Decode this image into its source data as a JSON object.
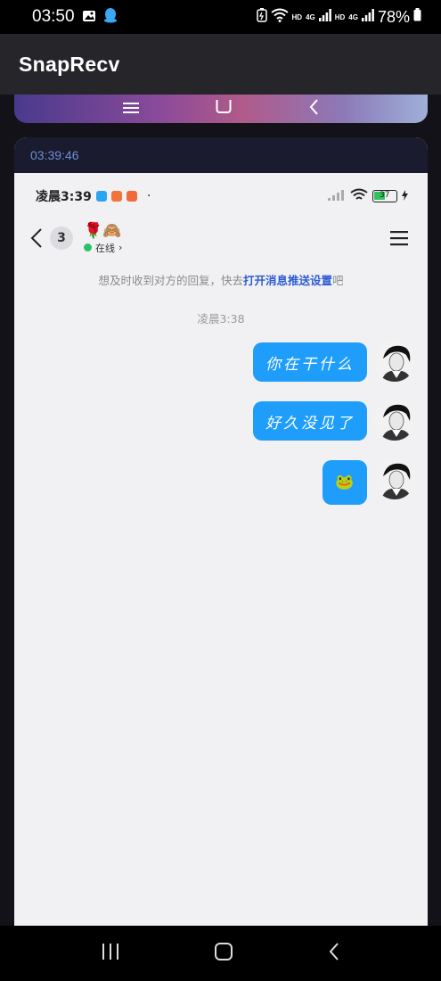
{
  "status_bar": {
    "time": "03:50",
    "net_label_1": "HD",
    "net_label_2": "4G",
    "net_label_3": "HD",
    "net_label_4": "4G",
    "battery": "78%"
  },
  "app_bar": {
    "title": "SnapRecv"
  },
  "entry": {
    "timestamp": "03:39:46"
  },
  "captured": {
    "status": {
      "time": "凌晨3:39",
      "battery": "37"
    },
    "chat_header": {
      "unread_count": "3",
      "contact_name": "🌹🙈",
      "online_status": "在线",
      "online_chevron": "›"
    },
    "notice": {
      "prefix": "想及时收到对方的回复，快去",
      "link": "打开消息推送设置",
      "suffix": "吧"
    },
    "chat_time": "凌晨3:38",
    "messages": [
      {
        "text": "你在干什么"
      },
      {
        "text": "好久没见了"
      },
      {
        "text": "🐸"
      }
    ]
  },
  "colors": {
    "bubble": "#1e9dfb",
    "online": "#27c26a",
    "link": "#2c5bd3",
    "timestamp": "#6d8fd6"
  }
}
